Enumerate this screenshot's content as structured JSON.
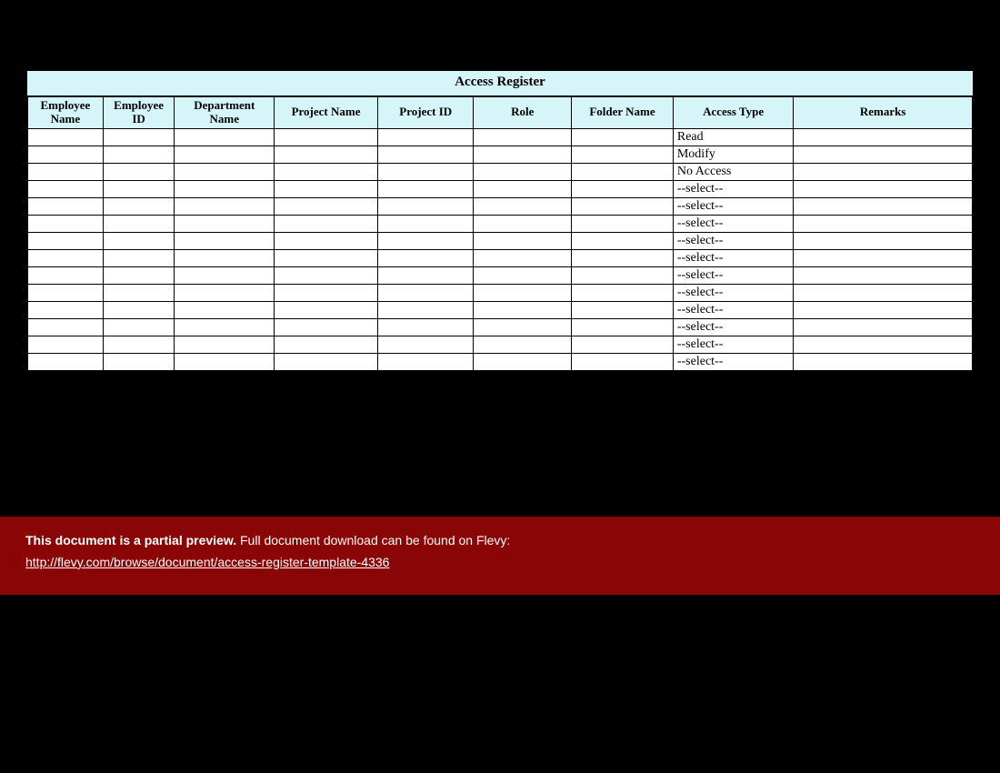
{
  "title": "Access Register",
  "columns": [
    "Employee Name",
    "Employee ID",
    "Department Name",
    "Project Name",
    "Project ID",
    "Role",
    "Folder Name",
    "Access Type",
    "Remarks"
  ],
  "rows": [
    {
      "access_type": "Read"
    },
    {
      "access_type": "Modify"
    },
    {
      "access_type": "No Access"
    },
    {
      "access_type": "--select--"
    },
    {
      "access_type": "--select--"
    },
    {
      "access_type": "--select--"
    },
    {
      "access_type": "--select--"
    },
    {
      "access_type": "--select--"
    },
    {
      "access_type": "--select--"
    },
    {
      "access_type": "--select--"
    },
    {
      "access_type": "--select--"
    },
    {
      "access_type": "--select--"
    },
    {
      "access_type": "--select--"
    },
    {
      "access_type": "--select--"
    }
  ],
  "banner": {
    "bold": "This document is a partial preview.",
    "rest": "  Full document download can be found on Flevy:",
    "link": "http://flevy.com/browse/document/access-register-template-4336"
  }
}
